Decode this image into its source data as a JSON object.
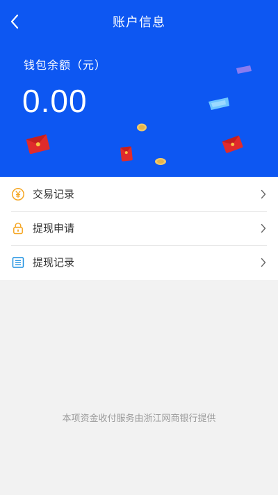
{
  "header": {
    "title": "账户信息",
    "back_icon": "chevron-left-icon"
  },
  "wallet": {
    "balance_label": "钱包余额（元）",
    "balance_value": "0.00"
  },
  "menu": {
    "items": [
      {
        "label": "交易记录",
        "icon": "yen-circle-icon"
      },
      {
        "label": "提现申请",
        "icon": "lock-icon"
      },
      {
        "label": "提现记录",
        "icon": "list-icon"
      }
    ]
  },
  "footer": {
    "note": "本项资金收付服务由浙江网商银行提供"
  },
  "colors": {
    "hero_bg": "#0d57f2",
    "accent_orange": "#f5a623",
    "accent_blue": "#1a8fe0",
    "page_bg": "#f2f2f2"
  }
}
